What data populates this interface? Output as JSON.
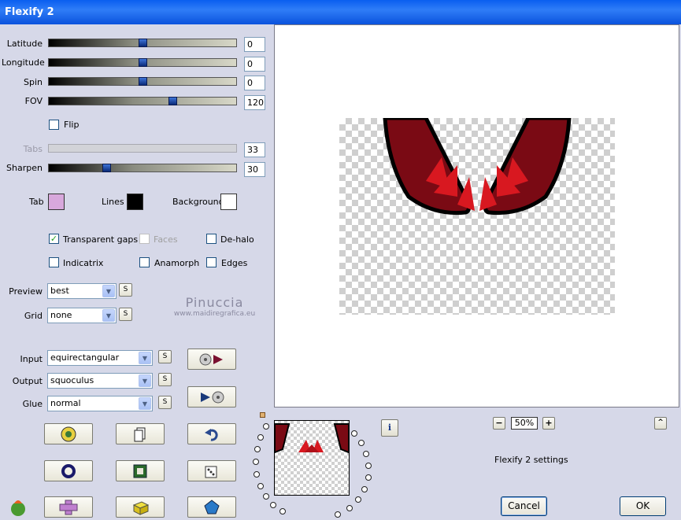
{
  "window": {
    "title": "Flexify 2"
  },
  "sliders": [
    {
      "label": "Latitude",
      "value": "0",
      "level": 0.5,
      "enabled": true
    },
    {
      "label": "Longitude",
      "value": "0",
      "level": 0.5,
      "enabled": true
    },
    {
      "label": "Spin",
      "value": "0",
      "level": 0.5,
      "enabled": true
    },
    {
      "label": "FOV",
      "value": "120",
      "level": 0.65,
      "enabled": true
    },
    {
      "label": "Tabs",
      "value": "33",
      "level": 0.0,
      "enabled": false
    },
    {
      "label": "Sharpen",
      "value": "30",
      "level": 0.3,
      "enabled": true
    }
  ],
  "flip": {
    "label": "Flip",
    "checked": false
  },
  "colors": {
    "tab": {
      "label": "Tab",
      "color": "#d8a8dc"
    },
    "lines": {
      "label": "Lines",
      "color": "#000000"
    },
    "background": {
      "label": "Background",
      "color": "#ffffff"
    }
  },
  "checkboxes": {
    "transparent_gaps": {
      "label": "Transparent gaps",
      "checked": true
    },
    "faces": {
      "label": "Faces",
      "checked": false,
      "enabled": false
    },
    "de_halo": {
      "label": "De-halo",
      "checked": false
    },
    "indicatrix": {
      "label": "Indicatrix",
      "checked": false
    },
    "anamorph": {
      "label": "Anamorph",
      "checked": false
    },
    "edges": {
      "label": "Edges",
      "checked": false
    }
  },
  "selects": {
    "preview": {
      "label": "Preview",
      "value": "best"
    },
    "grid": {
      "label": "Grid",
      "value": "none"
    },
    "input": {
      "label": "Input",
      "value": "equirectangular"
    },
    "output": {
      "label": "Output",
      "value": "squoculus"
    },
    "glue": {
      "label": "Glue",
      "value": "normal"
    }
  },
  "s_button_label": "S",
  "watermark": {
    "name": "Pinuccia",
    "url": "www.maidiregrafica.eu"
  },
  "zoom": {
    "value": "50%",
    "minus": "−",
    "plus": "+"
  },
  "info_button": "i",
  "scroll_up": "^",
  "settings_caption": "Flexify 2 settings",
  "footer": {
    "cancel": "Cancel",
    "ok": "OK"
  },
  "accent_colors": {
    "title_bar": "#0a5ef0",
    "dialog_bg": "#d6d8e8"
  }
}
